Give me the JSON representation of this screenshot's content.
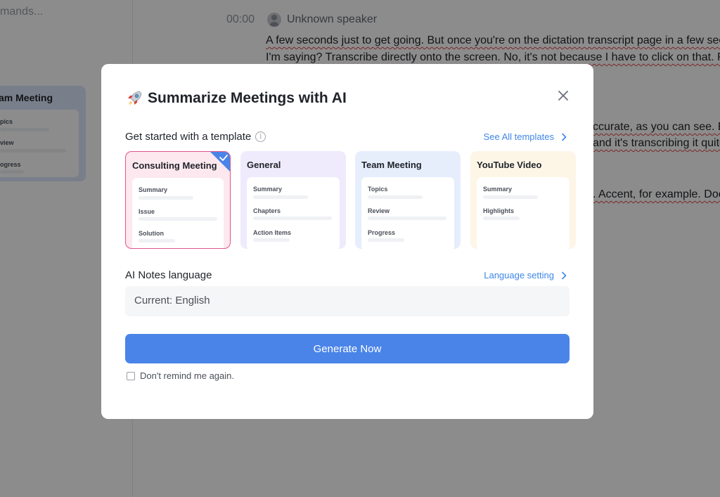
{
  "background": {
    "command_hint": "mands...",
    "left_card": {
      "title": "am Meeting",
      "rows": [
        "pics",
        "view",
        "ogress"
      ]
    },
    "transcript": {
      "timestamp": "00:00",
      "speaker": "Unknown speaker",
      "lines": [
        "A few seconds just to get going. But once you're on the dictation transcript page in a few seco",
        "I'm saying? Transcribe directly onto the screen. No, it's not because I have to click on that. Rig",
        "ccurate, as you can see. Ev",
        "and it's transcribing it quite",
        ". Accent, for example. Doe"
      ]
    }
  },
  "modal": {
    "title": "Summarize Meetings with AI",
    "rocket_emoji": "🚀",
    "template_section": {
      "label": "Get started with a template",
      "see_all": "See All templates",
      "templates": [
        {
          "name": "Consulting Meeting",
          "rows": [
            "Summary",
            "Issue",
            "Solution"
          ],
          "selected": true,
          "bg": "#fde8ef"
        },
        {
          "name": "General",
          "rows": [
            "Summary",
            "Chapters",
            "Action Items"
          ],
          "selected": false,
          "bg": "#efeafc"
        },
        {
          "name": "Team Meeting",
          "rows": [
            "Topics",
            "Review",
            "Progress"
          ],
          "selected": false,
          "bg": "#e6eefc"
        },
        {
          "name": "YouTube Video",
          "rows": [
            "Summary",
            "Highlights"
          ],
          "selected": false,
          "bg": "#fdf5e6"
        }
      ]
    },
    "language_section": {
      "label": "AI Notes language",
      "setting_link": "Language setting",
      "current": "Current: English"
    },
    "generate_label": "Generate Now",
    "dont_remind_label": "Don't remind me again."
  },
  "colors": {
    "accent": "#4a84e8",
    "link": "#3f86e8",
    "selected_border": "#e0558f"
  }
}
